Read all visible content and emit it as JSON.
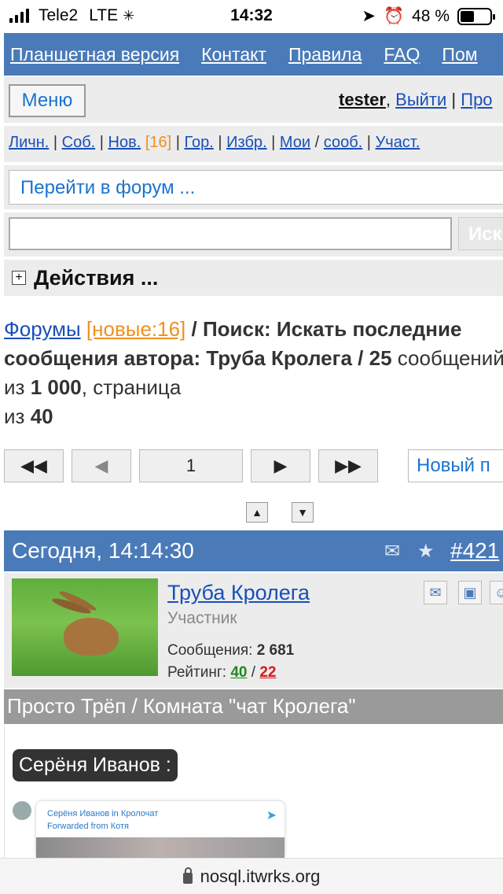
{
  "status": {
    "carrier": "Tele2",
    "network": "LTE",
    "time": "14:32",
    "battery": "48 %",
    "battery_level": 0.48
  },
  "topnav": [
    "Планшетная версия",
    "Контакт",
    "Правила",
    "FAQ",
    "Пом"
  ],
  "userbar": {
    "menu": "Меню",
    "user": "tester",
    "logout": "Выйти",
    "more": "Про"
  },
  "quick": {
    "items": [
      "Личн.",
      "Соб.",
      "Нов.",
      "[16]",
      "Гор.",
      "Избр.",
      "Мои",
      "сооб.",
      "Участ."
    ]
  },
  "goto": "Перейти в форум ...",
  "search": {
    "button": "Иск",
    "value": ""
  },
  "actions": {
    "label": "Действия ..."
  },
  "crumbs": {
    "forums": "Форумы",
    "new": "[новые:16]",
    "sep": "/",
    "search_title": "Поиск: Искать последние сообщения автора: Труба Кролега",
    "count": "25",
    "messages_of": "сообщений из",
    "total": "1 000",
    "page_word": ", страница",
    "of": "из",
    "pages": "40"
  },
  "pager": {
    "page": "1",
    "new_post": "Новый п"
  },
  "post": {
    "date": "Сегодня, 14:14:30",
    "number": "#421",
    "author": "Труба Кролега",
    "role": "Участник",
    "messages_label": "Сообщения:",
    "messages": "2 681",
    "rating_label": "Рейтинг:",
    "rating_pos": "40",
    "rating_neg": "22",
    "topic": "Просто Трёп / Комната \"чат Кролега\"",
    "quote_author": "Серёня Иванов :",
    "tg_line1": "Серёня Иванов in Кролочат",
    "tg_line2": "Forwarded from Котя"
  },
  "url": "nosql.itwrks.org"
}
